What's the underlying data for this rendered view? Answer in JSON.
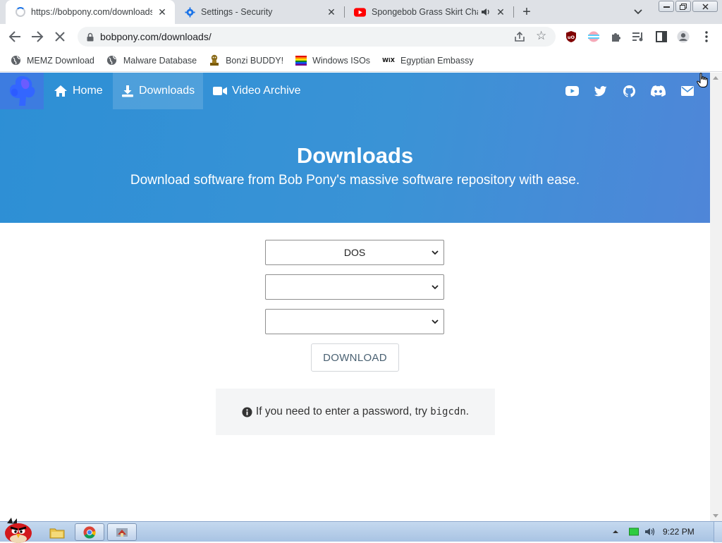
{
  "browser": {
    "tabs": [
      {
        "title": "https://bobpony.com/downloads",
        "active": true,
        "favicon": "loading-spinner"
      },
      {
        "title": "Settings - Security",
        "active": false,
        "favicon": "gear-icon"
      },
      {
        "title": "Spongebob Grass Skirt Chase",
        "active": false,
        "favicon": "youtube-icon",
        "audio": true
      }
    ],
    "url": "bobpony.com/downloads/",
    "bookmarks": [
      {
        "label": "MEMZ Download",
        "icon": "globe-icon"
      },
      {
        "label": "Malware Database",
        "icon": "globe-icon"
      },
      {
        "label": "Bonzi BUDDY!",
        "icon": "bonzi-icon"
      },
      {
        "label": "Windows ISOs",
        "icon": "rainbow-flag-icon"
      },
      {
        "label": "Egyptian Embassy",
        "icon": "wix-icon"
      }
    ],
    "wix_glyph": "WiX"
  },
  "site": {
    "nav": [
      {
        "label": "Home",
        "icon": "home-icon"
      },
      {
        "label": "Downloads",
        "icon": "download-icon",
        "active": true
      },
      {
        "label": "Video Archive",
        "icon": "video-icon"
      }
    ],
    "social": [
      "youtube-icon",
      "twitter-icon",
      "github-icon",
      "discord-icon",
      "email-icon"
    ],
    "hero": {
      "title": "Downloads",
      "subtitle": "Download software from Bob Pony's massive software repository with ease."
    },
    "selects": [
      {
        "value": "DOS"
      },
      {
        "value": ""
      },
      {
        "value": ""
      }
    ],
    "download_button": "DOWNLOAD",
    "info": {
      "text": "If you need to enter a password, try ",
      "password": "bigcdn",
      "suffix": "."
    },
    "colors": {
      "hero_start": "#2d8fd5",
      "hero_end": "#4f86d8",
      "brand_bg": "#3d7ce0"
    }
  },
  "taskbar": {
    "clock": "9:22 PM",
    "items": [
      "angry-birds-start-icon",
      "explorer-icon",
      "chrome-icon",
      "app-icon"
    ]
  }
}
